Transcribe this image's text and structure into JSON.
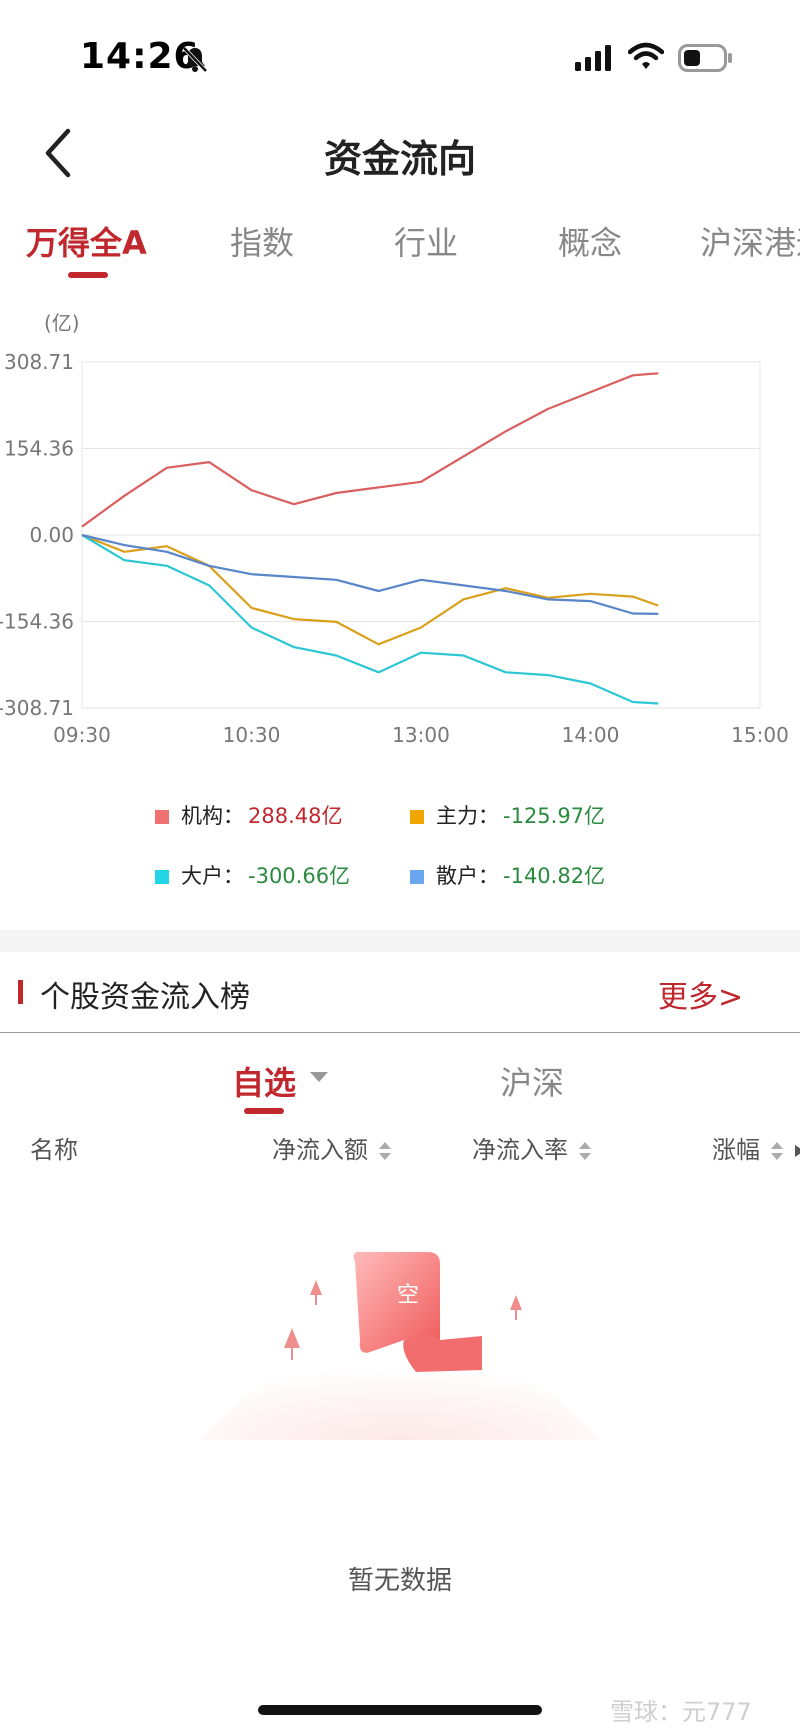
{
  "status_bar": {
    "time": "14:26"
  },
  "nav": {
    "title": "资金流向"
  },
  "tabs": [
    {
      "label": "万得全A",
      "active": true
    },
    {
      "label": "指数",
      "active": false
    },
    {
      "label": "行业",
      "active": false
    },
    {
      "label": "概念",
      "active": false
    },
    {
      "label": "沪深港通",
      "active": false
    }
  ],
  "chart_data": {
    "type": "line",
    "unit_label": "(亿)",
    "y_ticks": [
      "308.71",
      "154.36",
      "0.00",
      "-154.36",
      "-308.71"
    ],
    "x_ticks": [
      "09:30",
      "10:30",
      "13:00",
      "14:00",
      "15:00"
    ],
    "ylim": [
      -308.71,
      308.71
    ],
    "grid": true,
    "x": [
      0,
      0.25,
      0.5,
      0.75,
      1,
      1.25,
      1.5,
      1.75,
      2,
      2.25,
      2.5,
      2.75,
      3,
      3.25,
      3.4
    ],
    "series": [
      {
        "name": "机构",
        "color": "#d9605f",
        "values": [
          15,
          70,
          120,
          130,
          80,
          55,
          75,
          85,
          95,
          140,
          185,
          225,
          255,
          285,
          288.48
        ]
      },
      {
        "name": "主力",
        "color": "#d9a01c",
        "values": [
          0,
          -30,
          -20,
          -55,
          -130,
          -150,
          -155,
          -195,
          -165,
          -115,
          -95,
          -112,
          -105,
          -110,
          -125.97
        ]
      },
      {
        "name": "大户",
        "color": "#2cc7d2",
        "values": [
          0,
          -45,
          -55,
          -90,
          -165,
          -200,
          -215,
          -245,
          -210,
          -215,
          -245,
          -250,
          -265,
          -298,
          -300.66
        ]
      },
      {
        "name": "散户",
        "color": "#5a85c8",
        "values": [
          0,
          -18,
          -30,
          -55,
          -70,
          -75,
          -80,
          -100,
          -80,
          -90,
          -100,
          -115,
          -118,
          -140,
          -140.82
        ]
      }
    ]
  },
  "legend": [
    {
      "name": "机构：",
      "value": "288.48亿",
      "color": "#f07171",
      "value_color": "#c0282d"
    },
    {
      "name": "主力：",
      "value": "-125.97亿",
      "color": "#f0a500",
      "value_color": "#2a8a3e"
    },
    {
      "name": "大户：",
      "value": "-300.66亿",
      "color": "#22d6e8",
      "value_color": "#2a8a3e"
    },
    {
      "name": "散户：",
      "value": "-140.82亿",
      "color": "#6aa7ee",
      "value_color": "#2a8a3e"
    }
  ],
  "section": {
    "title": "个股资金流入榜",
    "more": "更多>"
  },
  "sub_tabs": {
    "self": "自选",
    "shsz": "沪深"
  },
  "table_headers": [
    "名称",
    "净流入额",
    "净流入率",
    "涨幅"
  ],
  "empty": {
    "badge": "空",
    "text": "暂无数据"
  },
  "watermark": "雪球：元777"
}
